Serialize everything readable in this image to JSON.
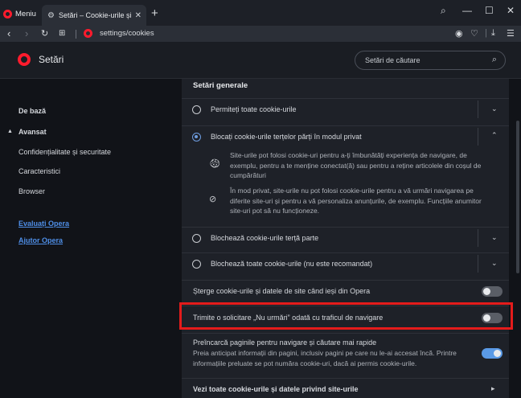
{
  "window": {
    "menu_label": "Meniu",
    "tab_title": "Setări – Cookie-urile și alte",
    "minimize_glyph": "—",
    "maximize_glyph": "☐",
    "close_glyph": "✕",
    "new_tab_glyph": "+"
  },
  "address": {
    "url": "settings/cookies",
    "icons": [
      "camera-icon",
      "heart-icon",
      "divider",
      "download-icon",
      "menu-lines-icon"
    ]
  },
  "header": {
    "title": "Setări",
    "search_placeholder": "Setări de căutare"
  },
  "sidebar": {
    "basic": "De bază",
    "advanced": "Avansat",
    "items": [
      "Confidențialitate și securitate",
      "Caracteristici",
      "Browser"
    ],
    "links": [
      "Evaluați Opera",
      "Ajutor Opera"
    ]
  },
  "content": {
    "section_title": "Setări generale",
    "options": [
      {
        "label": "Permiteți toate cookie-urile",
        "selected": false,
        "expanded": false
      },
      {
        "label": "Blocați cookie-urile terțelor părți în modul privat",
        "selected": true,
        "expanded": true
      },
      {
        "label": "Blochează cookie-urile terță parte",
        "selected": false,
        "expanded": false
      },
      {
        "label": "Blochează toate cookie-urile (nu este recomandat)",
        "selected": false,
        "expanded": false
      }
    ],
    "details": [
      {
        "icon": "cookie-icon",
        "text": "Site-urile pot folosi cookie-uri pentru a-ți îmbunătăți experiența de navigare, de exemplu, pentru a te menține conectat(ă) sau pentru a reține articolele din coșul de cumpărături"
      },
      {
        "icon": "block-icon",
        "text": "În mod privat, site-urile nu pot folosi cookie-urile pentru a vă urmări navigarea pe diferite site-uri și pentru a vă personaliza anunțurile, de exemplu. Funcțiile anumitor site-uri pot să nu funcționeze."
      }
    ],
    "toggles": [
      {
        "label": "Șterge cookie-urile și datele de site când ieși din Opera",
        "on": false
      },
      {
        "label": "Trimite o solicitare „Nu urmări” odată cu traficul de navigare",
        "on": false
      },
      {
        "label": "Preîncarcă paginile pentru navigare și căutare mai rapide",
        "sub": "Preia anticipat informații din pagini, inclusiv pagini pe care nu le-ai accesat încă. Printre informațiile preluate se pot număra cookie-uri, dacă ai permis cookie-urile.",
        "on": true
      }
    ],
    "see_all": "Vezi toate cookie-urile și datele privind site-urile"
  },
  "colors": {
    "accent": "#5a9ae6",
    "brand": "#ff1b2d",
    "highlight": "#e41b1b"
  }
}
